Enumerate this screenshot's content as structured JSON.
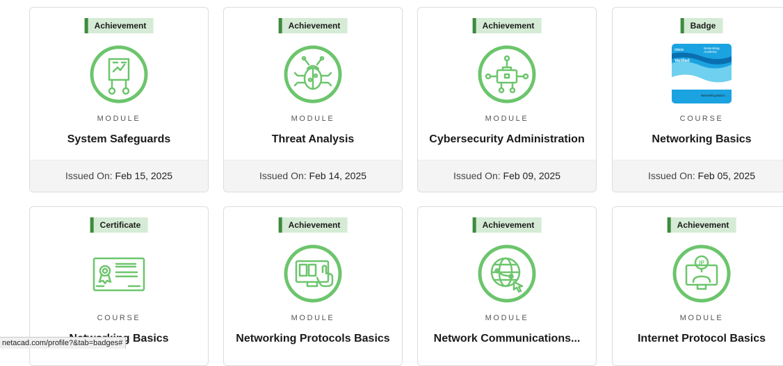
{
  "accent_green": "#6cc56c",
  "tag_bg": "#d5ebd5",
  "tag_border": "#3e8a3e",
  "issued_label": "Issued On:",
  "cards": [
    {
      "tag": "Achievement",
      "icon": "key-puzzle-icon",
      "kind": "MODULE",
      "title": "System Safeguards",
      "issued_date": "Feb 15, 2025"
    },
    {
      "tag": "Achievement",
      "icon": "bug-icon",
      "kind": "MODULE",
      "title": "Threat Analysis",
      "issued_date": "Feb 14, 2025"
    },
    {
      "tag": "Achievement",
      "icon": "briefcase-network-icon",
      "kind": "MODULE",
      "title": "Cybersecurity Administration",
      "issued_date": "Feb 09, 2025"
    },
    {
      "tag": "Badge",
      "icon": "cisco-networking-academy-badge",
      "kind": "COURSE",
      "title": "Networking Basics",
      "issued_date": "Feb 05, 2025",
      "badge_text": {
        "brand": "Networking",
        "brand2": "Academy",
        "verified": "Verified",
        "course": "Networking Basics"
      }
    },
    {
      "tag": "Certificate",
      "icon": "certificate-icon",
      "kind": "COURSE",
      "title": "Networking Basics"
    },
    {
      "tag": "Achievement",
      "icon": "monitor-touch-icon",
      "kind": "MODULE",
      "title": "Networking Protocols Basics"
    },
    {
      "tag": "Achievement",
      "icon": "globe-cursor-icon",
      "kind": "MODULE",
      "title": "Network Communications..."
    },
    {
      "tag": "Achievement",
      "icon": "ip-monitor-icon",
      "kind": "MODULE",
      "title": "Internet Protocol Basics"
    }
  ],
  "status_bar_url": "netacad.com/profile?&tab=badges#"
}
